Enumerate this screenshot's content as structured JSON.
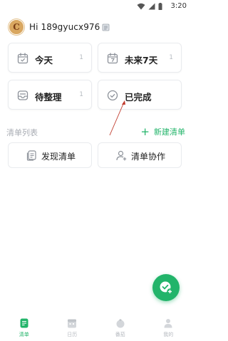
{
  "status_bar": {
    "time": "3:20"
  },
  "header": {
    "avatar_letter": "C",
    "greeting": "Hi 189gyucx976"
  },
  "cards": [
    {
      "label": "今天",
      "count": "1",
      "icon": "calendar-today-icon"
    },
    {
      "label": "未来7天",
      "count": "1",
      "icon": "calendar-7-icon"
    },
    {
      "label": "待整理",
      "count": "1",
      "icon": "inbox-icon"
    },
    {
      "label": "已完成",
      "count": "",
      "icon": "check-circle-icon"
    }
  ],
  "section": {
    "title": "清单列表",
    "new_label": "新建清单"
  },
  "actions": [
    {
      "label": "发现清单",
      "icon": "document-icon"
    },
    {
      "label": "清单协作",
      "icon": "user-add-icon"
    }
  ],
  "bottom_nav": [
    {
      "label": "清单",
      "icon": "list-icon",
      "active": true
    },
    {
      "label": "日历",
      "icon": "calendar-icon",
      "active": false
    },
    {
      "label": "番茄",
      "icon": "tomato-icon",
      "active": false
    },
    {
      "label": "我的",
      "icon": "person-icon",
      "active": false
    }
  ],
  "colors": {
    "accent": "#22b46a",
    "muted": "#b5b9bf",
    "card_border": "#e9ebee"
  }
}
